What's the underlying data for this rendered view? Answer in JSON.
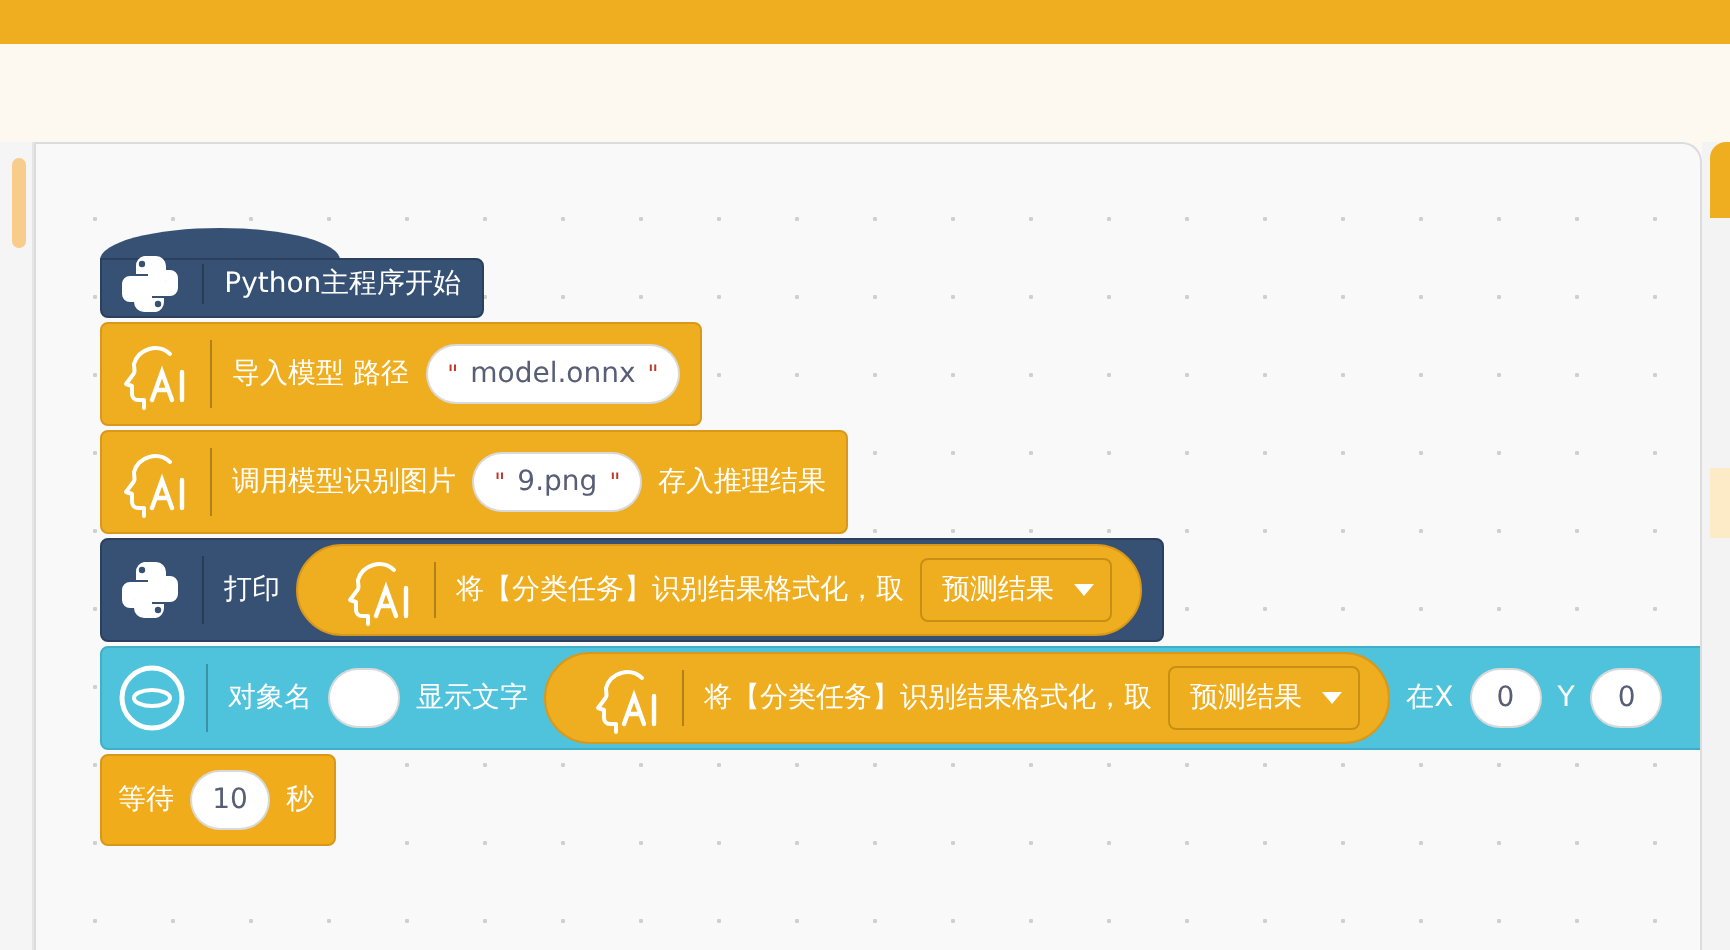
{
  "blocks": [
    {
      "kind": "start",
      "parts": [
        {
          "kind": "text",
          "text": "Python主程序开始"
        }
      ]
    },
    {
      "kind": "ai",
      "parts": [
        {
          "kind": "text",
          "text": "导入模型 路径"
        },
        {
          "kind": "string",
          "open": "\"",
          "value": "model.onnx",
          "close": "\""
        }
      ]
    },
    {
      "kind": "ai",
      "parts": [
        {
          "kind": "text",
          "text": "调用模型识别图片"
        },
        {
          "kind": "string",
          "open": "\"",
          "value": "9.png",
          "close": "\""
        },
        {
          "kind": "text",
          "text": "存入推理结果"
        }
      ]
    },
    {
      "kind": "python",
      "parts": [
        {
          "kind": "text",
          "text": "打印"
        },
        {
          "kind": "reporter",
          "parts": [
            {
              "kind": "text",
              "text": "将【分类任务】识别结果格式化，取"
            },
            {
              "kind": "dropdown",
              "value": "预测结果"
            }
          ]
        }
      ]
    },
    {
      "kind": "display",
      "parts": [
        {
          "kind": "text",
          "text": "对象名"
        },
        {
          "kind": "input"
        },
        {
          "kind": "text",
          "text": "显示文字"
        },
        {
          "kind": "reporter",
          "parts": [
            {
              "kind": "text",
              "text": "将【分类任务】识别结果格式化，取"
            },
            {
              "kind": "dropdown",
              "value": "预测结果"
            }
          ]
        },
        {
          "kind": "text",
          "text": "在X"
        },
        {
          "kind": "input",
          "value": "0"
        },
        {
          "kind": "text",
          "text": "Y"
        },
        {
          "kind": "input",
          "value": "0"
        }
      ]
    },
    {
      "kind": "wait",
      "parts": [
        {
          "kind": "text",
          "text": "等待"
        },
        {
          "kind": "input",
          "value": "10"
        },
        {
          "kind": "text",
          "text": "秒"
        }
      ]
    }
  ]
}
